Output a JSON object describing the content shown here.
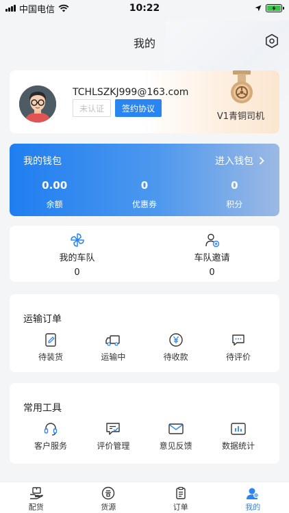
{
  "status_bar": {
    "carrier": "中国电信",
    "time": "10:22"
  },
  "header": {
    "title": "我的",
    "settings_icon": "hexagon-settings-icon"
  },
  "profile": {
    "email": "TCHLSZKJ999@163.com",
    "unverified_label": "未认证",
    "agreement_label": "签约协议",
    "level_label": "V1青铜司机",
    "medal_icon": "bronze-medal-icon"
  },
  "wallet": {
    "title": "我的钱包",
    "enter_label": "进入钱包",
    "stats": [
      {
        "value": "0.00",
        "label": "余额"
      },
      {
        "value": "0",
        "label": "优惠券"
      },
      {
        "value": "0",
        "label": "积分"
      }
    ]
  },
  "fleet": {
    "items": [
      {
        "label": "我的车队",
        "count": "0",
        "icon": "pinwheel-icon"
      },
      {
        "label": "车队邀请",
        "count": "0",
        "icon": "user-add-icon"
      }
    ]
  },
  "orders": {
    "title": "运输订单",
    "items": [
      {
        "label": "待装货",
        "icon": "edit-document-icon"
      },
      {
        "label": "运输中",
        "icon": "truck-icon"
      },
      {
        "label": "待收款",
        "icon": "yen-icon"
      },
      {
        "label": "待评价",
        "icon": "comment-icon"
      }
    ]
  },
  "tools": {
    "title": "常用工具",
    "items": [
      {
        "label": "客户服务",
        "icon": "headset-icon"
      },
      {
        "label": "评价管理",
        "icon": "rating-manage-icon"
      },
      {
        "label": "意见反馈",
        "icon": "mail-icon"
      },
      {
        "label": "数据统计",
        "icon": "bar-chart-icon"
      }
    ]
  },
  "tab_bar": {
    "items": [
      {
        "label": "配货",
        "icon": "dispatch-icon"
      },
      {
        "label": "货源",
        "icon": "cargo-icon"
      },
      {
        "label": "订单",
        "icon": "clipboard-icon"
      },
      {
        "label": "我的",
        "icon": "profile-icon"
      }
    ],
    "active_index": 3
  },
  "colors": {
    "accent": "#2b85f0",
    "background": "#f4f5f7"
  }
}
